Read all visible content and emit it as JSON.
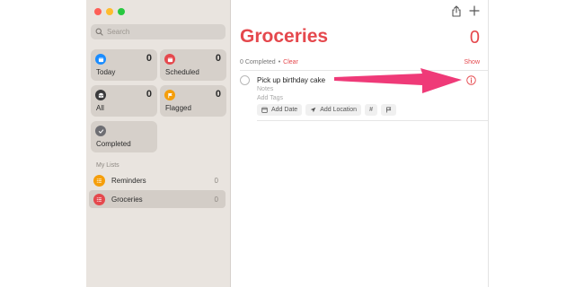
{
  "window": {
    "traffic_lights": [
      "close",
      "minimize",
      "zoom"
    ]
  },
  "sidebar": {
    "search": {
      "placeholder": "Search",
      "value": ""
    },
    "smart_lists": [
      {
        "label": "Today",
        "count": "0",
        "color": "#1a8cff",
        "icon": "calendar-icon"
      },
      {
        "label": "Scheduled",
        "count": "0",
        "color": "#e5484d",
        "icon": "calendar-clock-icon"
      },
      {
        "label": "All",
        "count": "0",
        "color": "#3a3a3c",
        "icon": "tray-icon"
      },
      {
        "label": "Flagged",
        "count": "0",
        "color": "#f59e0b",
        "icon": "flag-icon"
      },
      {
        "label": "Completed",
        "count": "",
        "color": "#6e6e73",
        "icon": "checkmark-icon"
      }
    ],
    "my_lists_header": "My Lists",
    "lists": [
      {
        "label": "Reminders",
        "count": "0",
        "color": "#f59e0b",
        "icon": "list-bullet-icon",
        "selected": false
      },
      {
        "label": "Groceries",
        "count": "0",
        "color": "#e5484d",
        "icon": "list-bullet-icon",
        "selected": true
      }
    ]
  },
  "toolbar": {
    "share_icon": "share-icon",
    "add_icon": "plus-icon"
  },
  "main": {
    "title": "Groceries",
    "count": "0",
    "completed_text": "0 Completed",
    "separator": "•",
    "clear_label": "Clear",
    "show_label": "Show",
    "accent_color": "#e5484d",
    "task": {
      "title": "Pick up birthday cake",
      "notes_placeholder": "Notes",
      "tags_placeholder": "Add Tags",
      "add_date": "Add Date",
      "add_location": "Add Location",
      "tag_symbol": "#",
      "flag_icon": "flag-icon",
      "info_icon": "info-circle-icon"
    }
  },
  "annotation": {
    "arrow_color": "#ef3a78",
    "arrow_icon": "pointer-arrow"
  }
}
